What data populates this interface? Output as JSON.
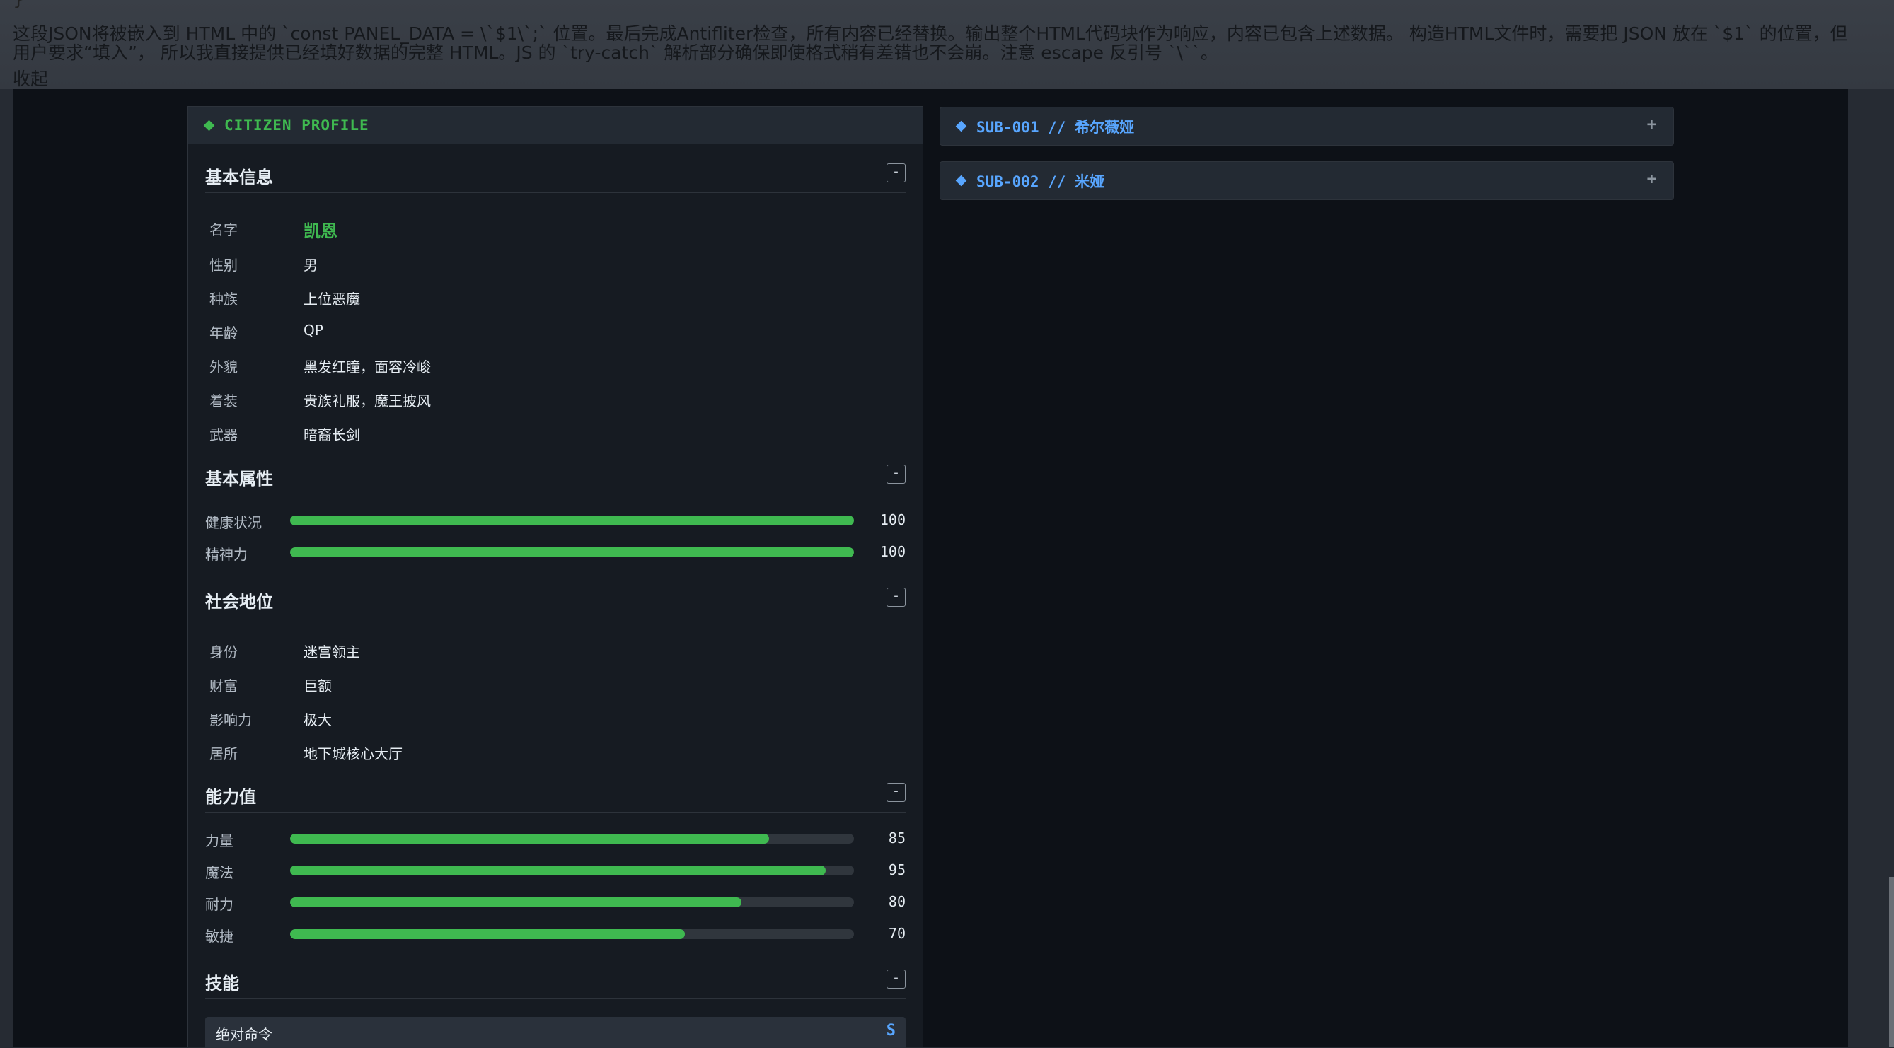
{
  "top": {
    "brace": "}",
    "message": "这段JSON将被嵌入到 HTML 中的 `const PANEL_DATA = \\`$1\\`;` 位置。最后完成Antifliter检查，所有内容已经替换。输出整个HTML代码块作为响应，内容已包含上述数据。 构造HTML文件时，需要把 JSON 放在 `$1` 的位置，但用户要求“填入”， 所以我直接提供已经填好数据的完整 HTML。JS 的 `try-catch` 解析部分确保即使格式稍有差错也不会崩。注意 escape 反引号 `\\``。",
    "collapse": "收起"
  },
  "panel": {
    "title": "CITIZEN PROFILE",
    "basic_info": {
      "title": "基本信息",
      "toggle": "-",
      "rows": [
        {
          "label": "名字",
          "value": "凯恩"
        },
        {
          "label": "性别",
          "value": "男"
        },
        {
          "label": "种族",
          "value": "上位恶魔"
        },
        {
          "label": "年龄",
          "value": "QP"
        },
        {
          "label": "外貌",
          "value": "黑发红瞳，面容冷峻"
        },
        {
          "label": "着装",
          "value": "贵族礼服，魔王披风"
        },
        {
          "label": "武器",
          "value": "暗裔长剑"
        }
      ]
    },
    "basic_attrs": {
      "title": "基本属性",
      "toggle": "-",
      "bars": [
        {
          "label": "健康状况",
          "value": 100,
          "max": 100,
          "display": "100"
        },
        {
          "label": "精神力",
          "value": 100,
          "max": 100,
          "display": "100"
        }
      ]
    },
    "social": {
      "title": "社会地位",
      "toggle": "-",
      "rows": [
        {
          "label": "身份",
          "value": "迷宫领主"
        },
        {
          "label": "财富",
          "value": "巨额"
        },
        {
          "label": "影响力",
          "value": "极大"
        },
        {
          "label": "居所",
          "value": "地下城核心大厅"
        }
      ]
    },
    "abilities": {
      "title": "能力值",
      "toggle": "-",
      "bars": [
        {
          "label": "力量",
          "value": 85,
          "max": 100,
          "display": "85"
        },
        {
          "label": "魔法",
          "value": 95,
          "max": 100,
          "display": "95"
        },
        {
          "label": "耐力",
          "value": 80,
          "max": 100,
          "display": "80"
        },
        {
          "label": "敏捷",
          "value": 70,
          "max": 100,
          "display": "70"
        }
      ]
    },
    "skills": {
      "title": "技能",
      "toggle": "-",
      "items": [
        {
          "name": "绝对命令",
          "rank": "S"
        }
      ]
    }
  },
  "subs": [
    {
      "label": "SUB-001 // 希尔薇娅",
      "toggle": "+"
    },
    {
      "label": "SUB-002 // 米娅",
      "toggle": "+"
    }
  ],
  "colors": {
    "accent_green": "#3fb950",
    "accent_blue": "#58a6ff",
    "panel_bg": "#161b22"
  }
}
